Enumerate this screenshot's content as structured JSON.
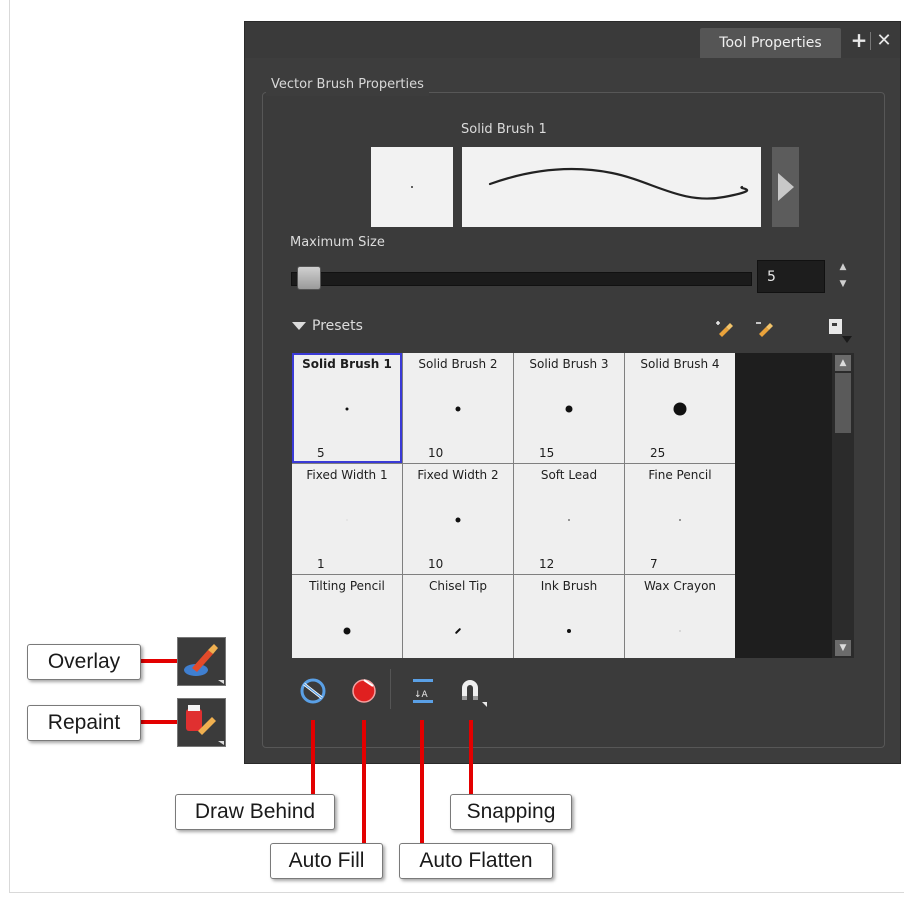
{
  "window": {
    "tab_title": "Tool Properties",
    "add_icon": "plus-icon",
    "close_icon": "close-icon"
  },
  "group_title": "Vector Brush Properties",
  "brush_preview": {
    "preset_name": "Solid Brush 1"
  },
  "max_size": {
    "label": "Maximum Size",
    "value": "5"
  },
  "presets": {
    "header": "Presets",
    "items": [
      {
        "name": "Solid Brush 1",
        "size": "5",
        "selected": true
      },
      {
        "name": "Solid Brush 2",
        "size": "10",
        "selected": false
      },
      {
        "name": "Solid Brush 3",
        "size": "15",
        "selected": false
      },
      {
        "name": "Solid Brush 4",
        "size": "25",
        "selected": false
      },
      {
        "name": "Fixed Width 1",
        "size": "1",
        "selected": false
      },
      {
        "name": "Fixed Width 2",
        "size": "10",
        "selected": false
      },
      {
        "name": "Soft Lead",
        "size": "12",
        "selected": false
      },
      {
        "name": "Fine Pencil",
        "size": "7",
        "selected": false
      },
      {
        "name": "Tilting Pencil",
        "size": "",
        "selected": false
      },
      {
        "name": "Chisel Tip",
        "size": "",
        "selected": false
      },
      {
        "name": "Ink Brush",
        "size": "",
        "selected": false
      },
      {
        "name": "Wax Crayon",
        "size": "",
        "selected": false
      }
    ]
  },
  "toolbar": {
    "draw_behind_icon": "draw-behind-icon",
    "auto_fill_icon": "auto-fill-icon",
    "auto_flatten_icon": "auto-flatten-icon",
    "snapping_icon": "snapping-icon"
  },
  "callouts": {
    "overlay": "Overlay",
    "repaint": "Repaint",
    "draw_behind": "Draw Behind",
    "auto_fill": "Auto Fill",
    "auto_flatten": "Auto Flatten",
    "snapping": "Snapping"
  },
  "colors": {
    "panel_bg": "#3d3d3d",
    "selection_outline": "#3a3ad6",
    "callout_line": "#e30000"
  }
}
